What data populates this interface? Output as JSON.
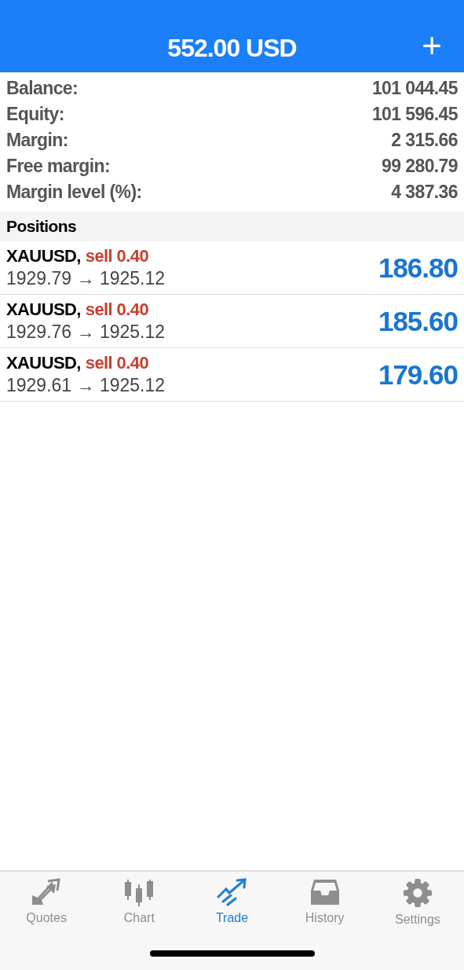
{
  "header": {
    "title": "552.00 USD",
    "add_button": "+"
  },
  "summary": [
    {
      "label": "Balance:",
      "value": "101 044.45"
    },
    {
      "label": "Equity:",
      "value": "101 596.45"
    },
    {
      "label": "Margin:",
      "value": "2 315.66"
    },
    {
      "label": "Free margin:",
      "value": "99 280.79"
    },
    {
      "label": "Margin level (%):",
      "value": "4 387.36"
    }
  ],
  "positions_header": "Positions",
  "positions": [
    {
      "symbol": "XAUUSD,",
      "order": "sell 0.40",
      "prices": "1929.79 → 1925.12",
      "profit": "186.80"
    },
    {
      "symbol": "XAUUSD,",
      "order": "sell 0.40",
      "prices": "1929.76 → 1925.12",
      "profit": "185.60"
    },
    {
      "symbol": "XAUUSD,",
      "order": "sell 0.40",
      "prices": "1929.61 → 1925.12",
      "profit": "179.60"
    }
  ],
  "tabs": [
    {
      "label": "Quotes",
      "kind": "quotes",
      "selected": false
    },
    {
      "label": "Chart",
      "kind": "chart",
      "selected": false
    },
    {
      "label": "Trade",
      "kind": "trade",
      "selected": true
    },
    {
      "label": "History",
      "kind": "history",
      "selected": false
    },
    {
      "label": "Settings",
      "kind": "settings",
      "selected": false
    }
  ]
}
